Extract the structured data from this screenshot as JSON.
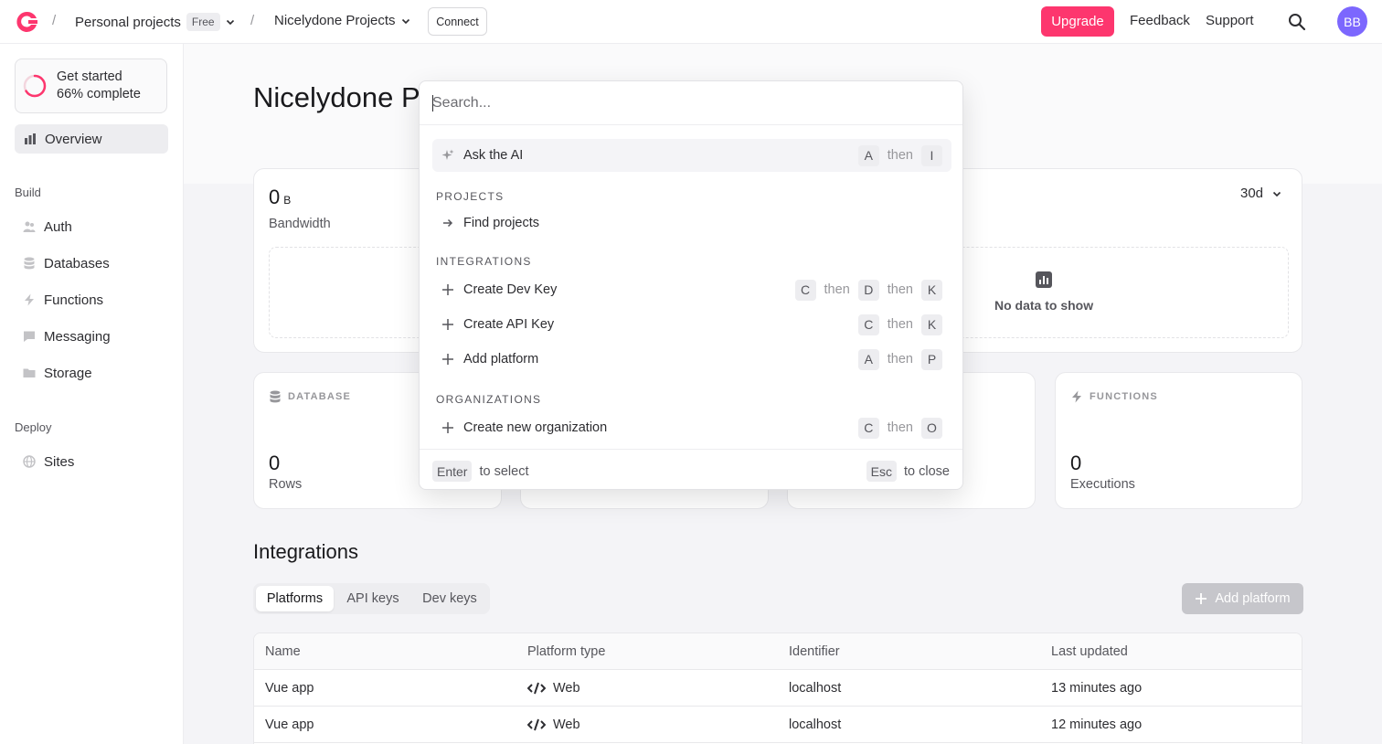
{
  "header": {
    "breadcrumb_sep": "/",
    "org_name": "Personal projects",
    "org_badge": "Free",
    "project_name": "Nicelydone Projects",
    "connect_label": "Connect",
    "upgrade_label": "Upgrade",
    "feedback_label": "Feedback",
    "support_label": "Support",
    "avatar_initials": "BB"
  },
  "sidebar": {
    "get_started_title": "Get started",
    "get_started_progress": "66% complete",
    "get_started_fraction": 0.66,
    "overview_label": "Overview",
    "build_section": "Build",
    "build_items": [
      {
        "label": "Auth",
        "icon": "users-icon"
      },
      {
        "label": "Databases",
        "icon": "database-icon"
      },
      {
        "label": "Functions",
        "icon": "lightning-icon"
      },
      {
        "label": "Messaging",
        "icon": "chat-icon"
      },
      {
        "label": "Storage",
        "icon": "folder-icon"
      }
    ],
    "deploy_section": "Deploy",
    "deploy_items": [
      {
        "label": "Sites",
        "icon": "globe-icon"
      }
    ]
  },
  "main": {
    "title": "Nicelydone Projects",
    "bandwidth_value": "0",
    "bandwidth_unit": "B",
    "bandwidth_label": "Bandwidth",
    "range_label": "30d",
    "no_data_label": "No data to show",
    "database_card": {
      "heading": "DATABASE",
      "value": "0",
      "label": "Rows"
    },
    "functions_card": {
      "heading": "FUNCTIONS",
      "value": "0",
      "label": "Executions"
    },
    "integrations_title": "Integrations",
    "tabs": [
      "Platforms",
      "API keys",
      "Dev keys"
    ],
    "active_tab": "Platforms",
    "add_platform_label": "Add platform",
    "table": {
      "headers": [
        "Name",
        "Platform type",
        "Identifier",
        "Last updated"
      ],
      "rows": [
        {
          "name": "Vue app",
          "type": "Web",
          "identifier": "localhost",
          "updated": "13 minutes ago"
        },
        {
          "name": "Vue app",
          "type": "Web",
          "identifier": "localhost",
          "updated": "12 minutes ago"
        }
      ]
    }
  },
  "palette": {
    "search_placeholder": "Search...",
    "then_word": "then",
    "ask_ai": {
      "label": "Ask the AI",
      "keys": [
        "A",
        "I"
      ]
    },
    "projects_section": "PROJECTS",
    "find_projects_label": "Find projects",
    "integrations_section": "INTEGRATIONS",
    "integration_items": [
      {
        "label": "Create Dev Key",
        "keys": [
          "C",
          "D",
          "K"
        ]
      },
      {
        "label": "Create API Key",
        "keys": [
          "C",
          "K"
        ]
      },
      {
        "label": "Add platform",
        "keys": [
          "A",
          "P"
        ]
      }
    ],
    "organizations_section": "ORGANIZATIONS",
    "org_item": {
      "label": "Create new organization",
      "keys": [
        "C",
        "O"
      ]
    },
    "footer": {
      "select_key": "Enter",
      "select_text": "to select",
      "close_key": "Esc",
      "close_text": "to close"
    }
  },
  "colors": {
    "brand": "#fd366e",
    "avatar": "#7c67fe"
  }
}
